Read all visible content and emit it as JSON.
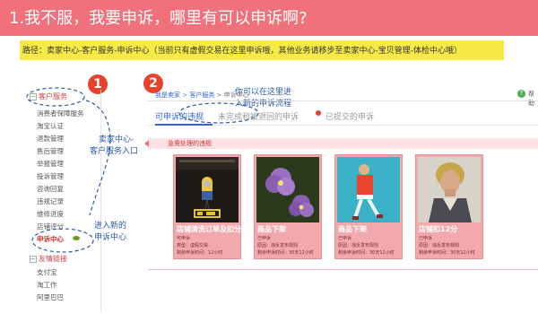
{
  "title": "1.我不服，我要申诉，哪里有可以申诉啊?",
  "path_note": "路径：卖家中心-客户服务-申诉中心（当前只有虚假交易在这里申诉哦，其他业务请移步至卖家中心-宝贝管理-体检中心哦）",
  "badges": {
    "one": "1",
    "two": "2"
  },
  "sidebar": {
    "group1": "客户服务",
    "group1_toggle": "−",
    "items": [
      "消费者保障服务",
      "淘宝认证",
      "退款管理",
      "售后管理",
      "举报管理",
      "投诉管理",
      "咨询回复",
      "违规记录",
      "维修进度",
      "店铺评分",
      "申诉中心"
    ],
    "group2": "友情链接",
    "group2_toggle": "−",
    "links": [
      "支付宝",
      "淘工作",
      "阿里巴巴"
    ]
  },
  "annotations": {
    "seller_line1": "卖家中心-",
    "seller_line2": "客户服务入口",
    "enter_line1": "进入新的",
    "enter_line2": "申诉中心",
    "flow_line1": "你可以在这里进",
    "flow_line2": "入新的申诉流程"
  },
  "panel": {
    "breadcrumb_home": "我是卖家",
    "breadcrumb_sep1": " > ",
    "breadcrumb_service": "客户服务",
    "breadcrumb_sep2": " > ",
    "breadcrumb_current": "申诉中心",
    "help_icon": "?",
    "help": "帮助",
    "tabs": [
      "可申诉的违规",
      "未完成和被退回的申诉",
      "已提交的申诉"
    ],
    "strip_label": "急需处理的违规"
  },
  "cards": [
    {
      "title": "店铺清洗订单及扣分",
      "sub": "可申诉",
      "line1": "类型：虚假交易",
      "line2": "剩余申诉时间：12小时"
    },
    {
      "title": "商品下架",
      "sub": "已申诉",
      "line1": "原因：违反发布规则",
      "line2": "剩余申诉时间：30天12小时"
    },
    {
      "title": "商品下架",
      "sub": "已申诉",
      "line1": "原因：违反发布规则",
      "line2": "剩余申诉时间：30天12小时"
    },
    {
      "title": "店铺扣12分",
      "sub": "已申诉",
      "line1": "原因：违反发布规则",
      "line2": "剩余申诉时间：30天12小时"
    }
  ],
  "colors": {
    "title_bg": "#f0717b",
    "path_bg": "#f7ea46",
    "badge": "#e8422c",
    "annotation": "#2a57a6",
    "card_bg": "#f2a9ae",
    "tab_active": "#3366cc"
  }
}
